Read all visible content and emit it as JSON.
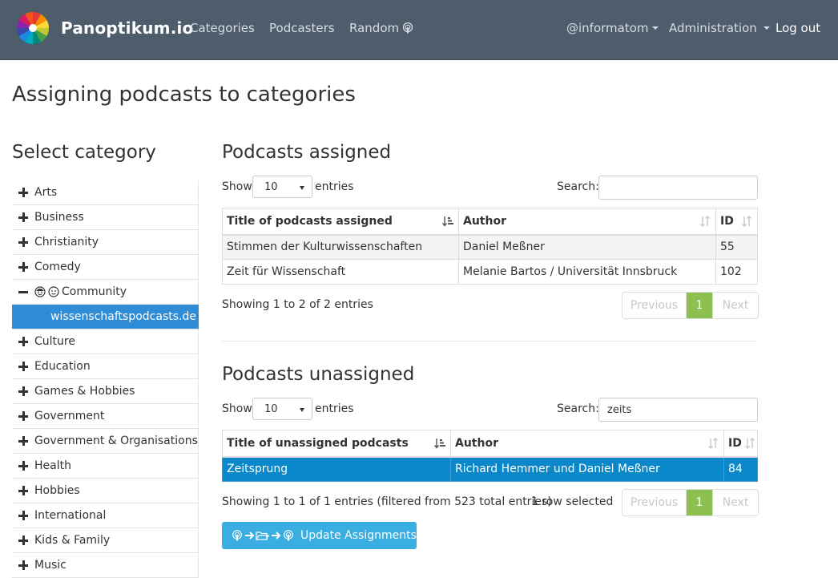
{
  "nav": {
    "brand": "Panoptikum.io",
    "categories": "Categories",
    "podcasters": "Podcasters",
    "random": "Random",
    "user": "@informatom",
    "administration": "Administration",
    "logout": "Log out"
  },
  "page": {
    "title": "Assigning podcasts to categories"
  },
  "sidebar": {
    "title": "Select category",
    "items": [
      {
        "label": "Arts"
      },
      {
        "label": "Business"
      },
      {
        "label": "Christianity"
      },
      {
        "label": "Comedy"
      },
      {
        "label": "Community"
      },
      {
        "label": "wissenschaftspodcasts.de"
      },
      {
        "label": "Culture"
      },
      {
        "label": "Education"
      },
      {
        "label": "Games & Hobbies"
      },
      {
        "label": "Government"
      },
      {
        "label": "Government & Organisations"
      },
      {
        "label": "Health"
      },
      {
        "label": "Hobbies"
      },
      {
        "label": "International"
      },
      {
        "label": "Kids & Family"
      },
      {
        "label": "Music"
      }
    ]
  },
  "assigned": {
    "title": "Podcasts assigned",
    "show": "Show",
    "entries_label": "entries",
    "length": "10",
    "search_label": "Search:",
    "search_value": "",
    "columns": [
      "Title of podcasts assigned",
      "Author",
      "ID"
    ],
    "rows": [
      [
        "Stimmen der Kulturwissenschaften",
        "Daniel Meßner",
        "55"
      ],
      [
        "Zeit für Wissenschaft",
        "Melanie Bartos / Universität Innsbruck",
        "102"
      ]
    ],
    "info": "Showing 1 to 2 of 2 entries",
    "previous": "Previous",
    "page": "1",
    "next": "Next"
  },
  "unassigned": {
    "title": "Podcasts unassigned",
    "show": "Show",
    "entries_label": "entries",
    "length": "10",
    "search_label": "Search:",
    "search_value": "zeits",
    "columns": [
      "Title of unassigned podcasts",
      "Author",
      "ID"
    ],
    "rows": [
      [
        "Zeitsprung",
        "Richard Hemmer und Daniel Meßner",
        "84"
      ]
    ],
    "info": "Showing 1 to 1 of 1 entries (filtered from 523 total entries)",
    "selected_info": "1 row selected",
    "previous": "Previous",
    "page": "1",
    "next": "Next"
  },
  "update_button": "Update Assignments",
  "colors": {
    "navbar": "#4e5d6c",
    "active_category": "#2f8cd6",
    "selected_row": "#0a88c9",
    "current_page": "#8cc152",
    "update_button": "#3aaee0"
  }
}
